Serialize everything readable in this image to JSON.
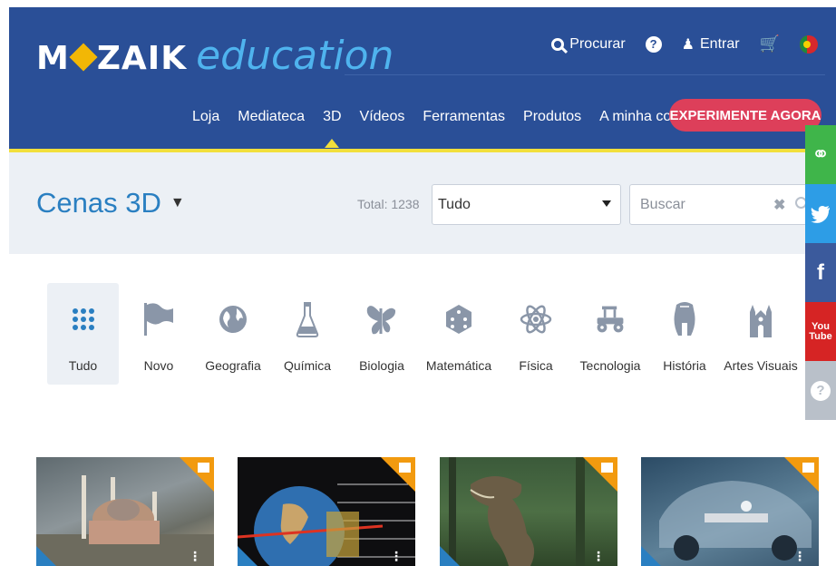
{
  "brand": {
    "name": "MOZAIK",
    "tagline": "education"
  },
  "topbar": {
    "search_label": "Procurar",
    "help_icon": "question-bubble-icon",
    "login_label": "Entrar",
    "cart_icon": "cart-icon",
    "language_icon": "portugal-flag-icon"
  },
  "nav": {
    "items": [
      "Loja",
      "Mediateca",
      "3D",
      "Vídeos",
      "Ferramentas",
      "Produtos",
      "A minha conta"
    ],
    "active": "3D",
    "cta": "EXPERIMENTE AGORA"
  },
  "filter": {
    "title": "Cenas 3D",
    "total": "Total: 1238",
    "select_value": "Tudo",
    "search_placeholder": "Buscar"
  },
  "categories": [
    {
      "label": "Tudo",
      "icon": "grid-dots-icon",
      "active": true
    },
    {
      "label": "Novo",
      "icon": "flag-icon"
    },
    {
      "label": "Geografia",
      "icon": "globe-icon"
    },
    {
      "label": "Química",
      "icon": "flask-icon"
    },
    {
      "label": "Biologia",
      "icon": "butterfly-icon"
    },
    {
      "label": "Matemática",
      "icon": "dice-icon"
    },
    {
      "label": "Física",
      "icon": "atom-icon"
    },
    {
      "label": "Tecnologia",
      "icon": "tractor-icon"
    },
    {
      "label": "História",
      "icon": "helmet-icon"
    },
    {
      "label": "Artes Visuais",
      "icon": "cathedral-icon"
    }
  ],
  "social": [
    "blog-icon",
    "twitter-icon",
    "facebook-icon",
    "youtube-icon",
    "help-icon"
  ],
  "colors": {
    "header": "#2a4f97",
    "accent_yellow": "#f2df3b",
    "cta": "#dd3f5a",
    "link_blue": "#2a7fc1",
    "badge_orange": "#f29a0f"
  }
}
